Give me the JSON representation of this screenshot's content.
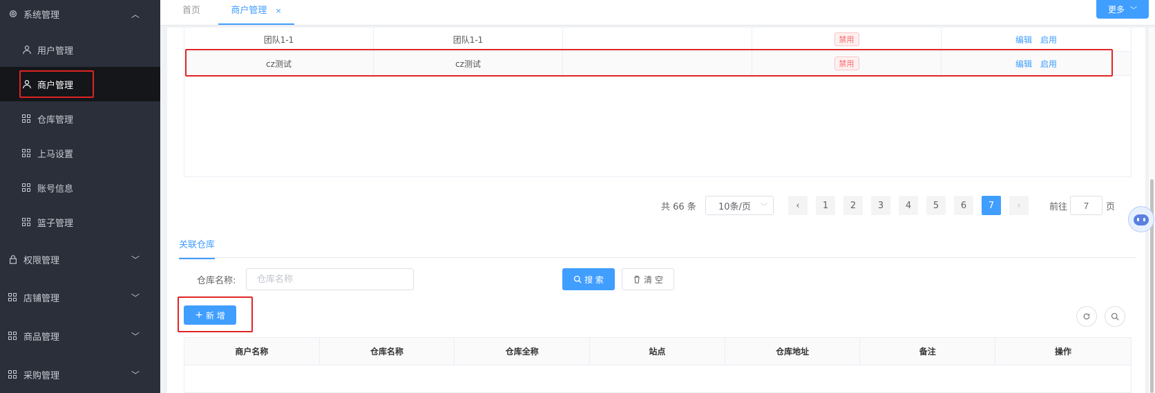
{
  "sidebar": {
    "system": {
      "label": "系统管理"
    },
    "sub_items": [
      {
        "label": "用户管理",
        "icon": "user-icon"
      },
      {
        "label": "商户管理",
        "icon": "merchant-icon"
      },
      {
        "label": "仓库管理",
        "icon": "grid-icon"
      },
      {
        "label": "上马设置",
        "icon": "grid-icon"
      },
      {
        "label": "账号信息",
        "icon": "grid-icon"
      },
      {
        "label": "篮子管理",
        "icon": "grid-icon"
      }
    ],
    "groups": [
      {
        "label": "权限管理",
        "icon": "lock-icon"
      },
      {
        "label": "店铺管理",
        "icon": "grid-icon"
      },
      {
        "label": "商品管理",
        "icon": "grid-icon"
      },
      {
        "label": "采购管理",
        "icon": "grid-icon"
      }
    ]
  },
  "tabs": {
    "home": "首页",
    "active": "商户管理",
    "close": "×",
    "more": "更多"
  },
  "top_table": {
    "rows": [
      {
        "name": "团队1-1",
        "fullname": "团队1-1",
        "status": "禁用",
        "edit": "编辑",
        "enable": "启用"
      },
      {
        "name": "cz测试",
        "fullname": "cz测试",
        "status": "禁用",
        "edit": "编辑",
        "enable": "启用"
      }
    ]
  },
  "pagination": {
    "total": "共 66 条",
    "page_size": "10条/页",
    "pages": [
      "1",
      "2",
      "3",
      "4",
      "5",
      "6",
      "7"
    ],
    "current": "7",
    "goto_prefix": "前往",
    "goto_value": "7",
    "goto_suffix": "页"
  },
  "section": {
    "tab": "关联仓库",
    "search_label": "仓库名称:",
    "search_placeholder": "仓库名称",
    "search_btn": "搜 索",
    "clear_btn": "清 空",
    "add_btn": "新 增"
  },
  "bottom_table": {
    "columns": [
      "商户名称",
      "仓库名称",
      "仓库全称",
      "站点",
      "仓库地址",
      "备注",
      "操作"
    ]
  },
  "colors": {
    "primary": "#409eff",
    "sidebar_bg": "#2b2f3a",
    "danger": "#f56c6c",
    "highlight": "#e02424"
  }
}
